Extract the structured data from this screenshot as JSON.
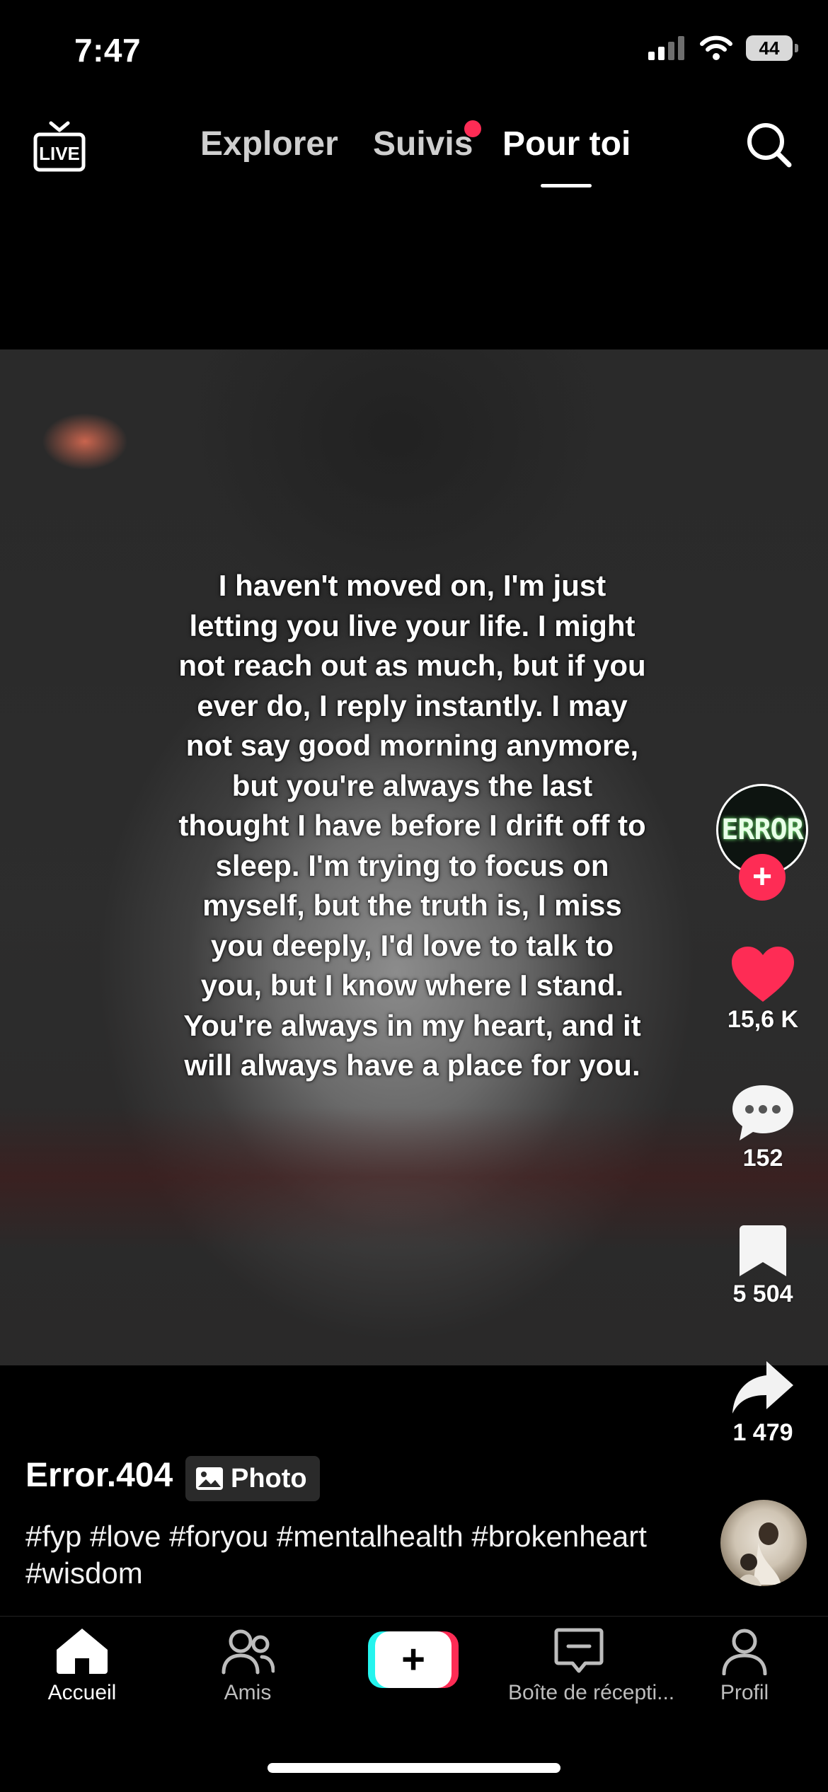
{
  "status_bar": {
    "time": "7:47",
    "battery": "44",
    "icons": [
      "signal-icon",
      "wifi-icon",
      "battery-icon"
    ]
  },
  "top_nav": {
    "live_label": "LIVE",
    "tabs": [
      {
        "label": "Explorer",
        "active": false
      },
      {
        "label": "Suivis",
        "active": false,
        "has_dot": true
      },
      {
        "label": "Pour toi",
        "active": true
      }
    ]
  },
  "post": {
    "quote": "I haven't moved on, I'm just letting you live your life. I might not reach out as much, but if you ever do, I reply instantly. I may not say good morning anymore, but you're always the last thought I have before I drift off to sleep. I'm trying to focus on myself, but the truth is, I miss you deeply, I'd love to talk to you, but I know where I stand. You're always in my heart, and it will always have a place for you.",
    "author": "Error.404",
    "badge": "Photo",
    "hashtags": "#fyp #love #foryou #mentalhealth #brokenheart #wisdom",
    "avatar_text": "ERROR"
  },
  "actions": {
    "likes": "15,6 K",
    "comments": "152",
    "saves": "5 504",
    "shares": "1 479"
  },
  "bottom_nav": {
    "home": "Accueil",
    "friends": "Amis",
    "inbox": "Boîte de récepti...",
    "profile": "Profil"
  },
  "colors": {
    "accent_red": "#fe2c55",
    "accent_cyan": "#25f4ee",
    "background": "#000000"
  }
}
